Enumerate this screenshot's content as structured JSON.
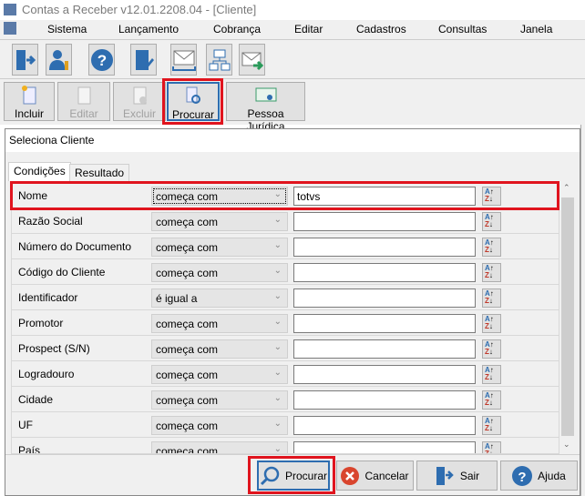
{
  "window": {
    "title": "Contas a Receber v12.01.2208.04 - [Cliente]"
  },
  "menu": [
    "Sistema",
    "Lançamento",
    "Cobrança",
    "Editar",
    "Cadastros",
    "Consultas",
    "Janela"
  ],
  "toolbar": {
    "icons": [
      "exit-door-icon",
      "user-key-icon",
      "help-icon",
      "building-edit-icon",
      "mail-inbox-icon",
      "org-chart-icon",
      "mail-send-icon"
    ]
  },
  "actions": [
    {
      "label": "Incluir",
      "enabled": true
    },
    {
      "label": "Editar",
      "enabled": false
    },
    {
      "label": "Excluir",
      "enabled": false
    },
    {
      "label": "Procurar",
      "enabled": true,
      "highlighted": true
    },
    {
      "label": "Pessoa Jurídica",
      "enabled": true
    }
  ],
  "dialog": {
    "title": "Seleciona Cliente",
    "tabs": [
      "Condições",
      "Resultado"
    ],
    "active_tab": "Condições",
    "rows": [
      {
        "field": "Nome",
        "operator": "começa com",
        "value": "totvs",
        "highlighted": true
      },
      {
        "field": "Razão Social",
        "operator": "começa com",
        "value": ""
      },
      {
        "field": "Número do Documento",
        "operator": "começa com",
        "value": ""
      },
      {
        "field": "Código do Cliente",
        "operator": "começa com",
        "value": ""
      },
      {
        "field": "Identificador",
        "operator": "é igual a",
        "value": ""
      },
      {
        "field": "Promotor",
        "operator": "começa com",
        "value": ""
      },
      {
        "field": "Prospect (S/N)",
        "operator": "começa com",
        "value": ""
      },
      {
        "field": "Logradouro",
        "operator": "começa com",
        "value": ""
      },
      {
        "field": "Cidade",
        "operator": "começa com",
        "value": ""
      },
      {
        "field": "UF",
        "operator": "começa com",
        "value": ""
      },
      {
        "field": "País",
        "operator": "começa com",
        "value": ""
      }
    ],
    "buttons": {
      "search": "Procurar",
      "cancel": "Cancelar",
      "exit": "Sair",
      "help": "Ajuda"
    }
  },
  "colors": {
    "highlight": "#e0141e",
    "icon_blue": "#2e6db0"
  }
}
